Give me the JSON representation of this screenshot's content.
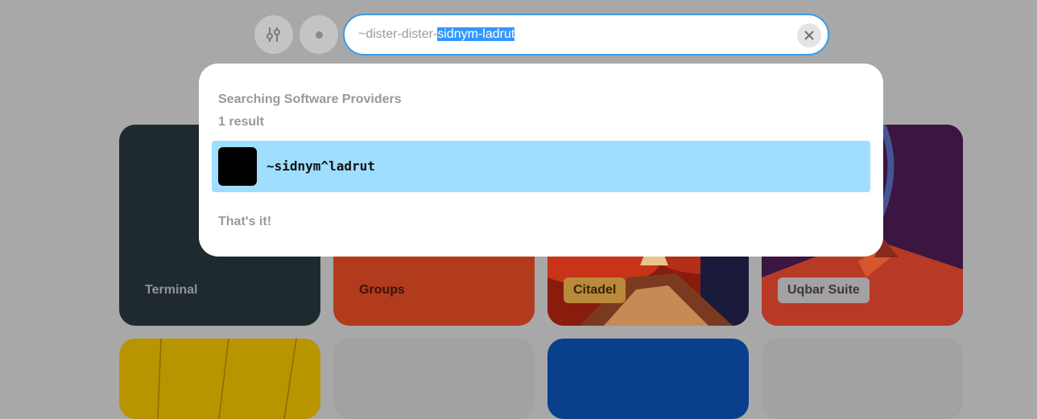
{
  "search": {
    "prefix": "~dister-dister-",
    "selected": "sidnym-ladrut"
  },
  "controls": {
    "settings_icon": "sliders-icon",
    "dot_icon": "dot-icon",
    "clear_icon": "close-icon"
  },
  "results_panel": {
    "heading": "Searching Software Providers",
    "count": "1 result",
    "items": [
      {
        "name": "~sidnym^ladrut",
        "avatar_color": "#000000"
      }
    ],
    "footer": "That's it!",
    "highlight_color": "#a0deff"
  },
  "tiles": [
    {
      "label": "Terminal",
      "color": "#1f2a2e"
    },
    {
      "label": "Groups",
      "color": "#b23a1d"
    },
    {
      "label": "Citadel",
      "color": "#8a1c0e"
    },
    {
      "label": "Uqbar Suite",
      "color": "#3a1640"
    }
  ],
  "colors": {
    "accent": "#3b9ce8",
    "selection": "#3297fd",
    "overlay": "#a8a8a8"
  }
}
